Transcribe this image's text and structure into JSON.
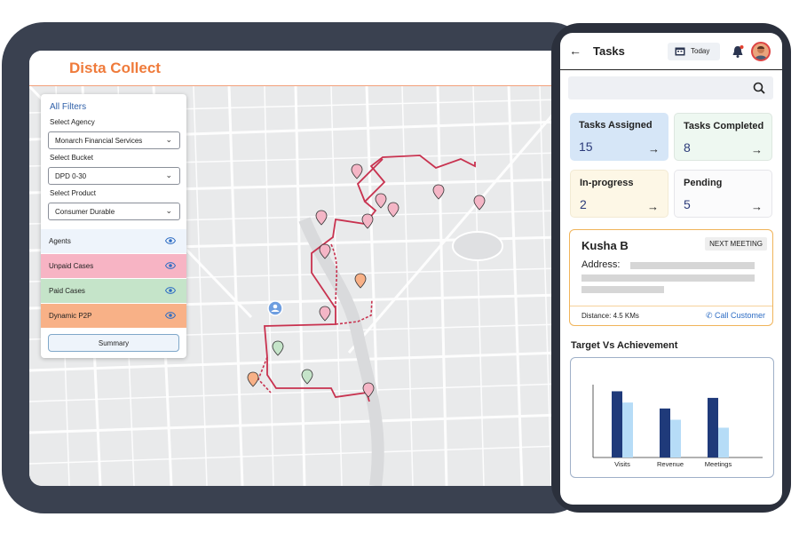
{
  "desktop": {
    "brand": "Dista Collect",
    "filters": {
      "title": "All Filters",
      "agency_label": "Select Agency",
      "agency_value": "Monarch Financial Services",
      "bucket_label": "Select Bucket",
      "bucket_value": "DPD 0-30",
      "product_label": "Select Product",
      "product_value": "Consumer Durable",
      "layers": [
        {
          "label": "Agents",
          "color": "#eef4fb"
        },
        {
          "label": "Unpaid Cases",
          "color": "#f7b4c4"
        },
        {
          "label": "Paid Cases",
          "color": "#c5e4c9"
        },
        {
          "label": "Dynamic P2P",
          "color": "#f8b187"
        }
      ],
      "summary_label": "Summary"
    },
    "map_icons": [
      "map-pin-icon",
      "agent-location-icon"
    ]
  },
  "phone": {
    "title": "Tasks",
    "today_label": "Today",
    "cards": [
      {
        "title": "Tasks Assigned",
        "value": "15",
        "color": "#d6e6f7"
      },
      {
        "title": "Tasks Completed",
        "value": "8",
        "color": "#eef8f1"
      },
      {
        "title": "In-progress",
        "value": "2",
        "color": "#fdf7e6"
      },
      {
        "title": "Pending",
        "value": "5",
        "color": "#fbfbfc"
      }
    ],
    "meeting": {
      "name": "Kusha B",
      "badge": "NEXT MEETING",
      "address_label": "Address:",
      "distance": "Distance: 4.5 KMs",
      "call_label": "Call Customer"
    },
    "chart_title": "Target Vs Achievement"
  },
  "colors": {
    "accent": "#ef7b3b",
    "route": "#c8324f",
    "target": "#1f3a7a",
    "achievement": "#b6dcf7"
  },
  "chart_data": {
    "type": "bar",
    "categories": [
      "Visits",
      "Revenue",
      "Meetings"
    ],
    "series": [
      {
        "values": [
          100,
          74,
          90
        ]
      },
      {
        "values": [
          83,
          57,
          45
        ]
      }
    ],
    "title": "Target Vs Achievement",
    "xlabel": "",
    "ylabel": "",
    "ylim": [
      0,
      110
    ],
    "grid": false
  }
}
